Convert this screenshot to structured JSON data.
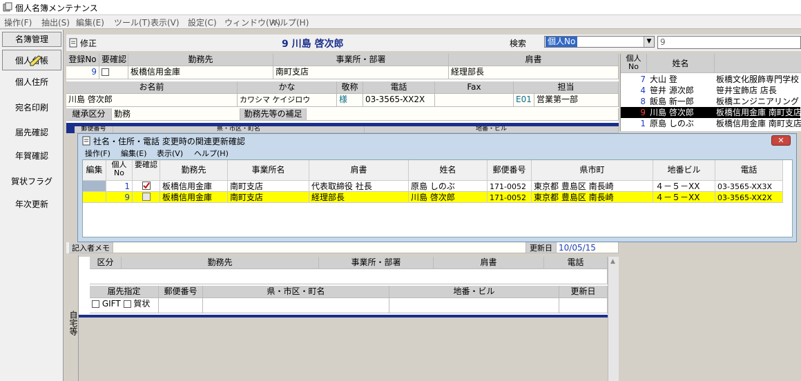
{
  "window": {
    "title": "個人名簿メンテナンス"
  },
  "menu": [
    "操作(F)",
    "抽出(S)",
    "編集(E)",
    "ツール(T)",
    "表示(V)",
    "設定(C)",
    "ウィンドウ(W)",
    "ヘルプ(H)"
  ],
  "sidebar": {
    "header": "名簿管理",
    "items": [
      "個人台帳",
      "個人住所",
      "宛名印刷",
      "届先確認",
      "年賀確認",
      "賀状フラグ",
      "年次更新"
    ]
  },
  "form": {
    "mode": "修正",
    "record_title": "9 川島 啓次郎",
    "search_label": "検索",
    "search_field": "個人No",
    "search_value": "9",
    "headers1": [
      "登録No",
      "要確認",
      "勤務先",
      "事業所・部署",
      "肩書"
    ],
    "row1": {
      "reg_no": "9",
      "company": "板橋信用金庫",
      "branch": "南町支店",
      "title": "経理部長"
    },
    "headers2": [
      "お名前",
      "かな",
      "敬称",
      "電話",
      "Fax",
      "担当"
    ],
    "row2": {
      "name": "川島 啓次郎",
      "kana": "カワシマ ケイジロウ",
      "honorific": "様",
      "phone": "03-3565-XX2X",
      "fax": "",
      "staff_code": "E01",
      "staff_name": "営業第一部"
    },
    "succession_label": "継承区分",
    "succession_value": "勤務",
    "supplement_label": "勤務先等の補足",
    "zip_label": "郵便番号",
    "pref_label": "県・市区・町名",
    "addr_label": "地番・ビル",
    "memo_label": "記入者メモ",
    "updated_label": "更新日",
    "updated_value": "10/05/15"
  },
  "rightlist": {
    "headers": [
      "個人No",
      "姓名"
    ],
    "rows": [
      {
        "no": "7",
        "name": "大山 登",
        "company": "板橋文化服飾専門学校"
      },
      {
        "no": "4",
        "name": "笹井 源次郎",
        "company": "笹井宝飾店 店長"
      },
      {
        "no": "8",
        "name": "飯島 新一郎",
        "company": "板橋エンジニアリング"
      },
      {
        "no": "9",
        "name": "川島 啓次郎",
        "company": "板橋信用金庫 南町支店"
      },
      {
        "no": "1",
        "name": "原島 しのぶ",
        "company": "板橋信用金庫 南町支店"
      }
    ]
  },
  "dialog": {
    "title": "社名・住所・電話 変更時の関連更新確認",
    "menu": [
      "操作(F)",
      "編集(E)",
      "表示(V)",
      "ヘルプ(H)"
    ],
    "headers": [
      "編集",
      "個人No",
      "要確認",
      "勤務先",
      "事業所名",
      "肩書",
      "姓名",
      "郵便番号",
      "県市町",
      "地番ビル",
      "電話"
    ],
    "rows": [
      {
        "no": "1",
        "company": "板橋信用金庫",
        "office": "南町支店",
        "title": "代表取締役 社長",
        "name": "原島 しのぶ",
        "zip": "171-0052",
        "pref": "東京都 豊島区 南長崎",
        "addr": "４－５－XX",
        "phone": "03-3565-XX3X"
      },
      {
        "no": "9",
        "company": "板橋信用金庫",
        "office": "南町支店",
        "title": "経理部長",
        "name": "川島 啓次郎",
        "zip": "171-0052",
        "pref": "東京都 豊島区 南長崎",
        "addr": "４－５－XX",
        "phone": "03-3565-XX2X"
      }
    ]
  },
  "home": {
    "side_label": "自宅等",
    "headers1": [
      "区分",
      "勤務先",
      "事業所・部署",
      "肩書",
      "電話"
    ],
    "headers2": [
      "届先指定",
      "郵便番号",
      "県・市区・町名",
      "地番・ビル",
      "更新日"
    ],
    "gift_label": "GIFT",
    "greeting_label": "賀状"
  },
  "colors": {
    "highlight_row": "#ffff00",
    "select_row": "#000000",
    "accent_blue": "#1f3fbf"
  }
}
